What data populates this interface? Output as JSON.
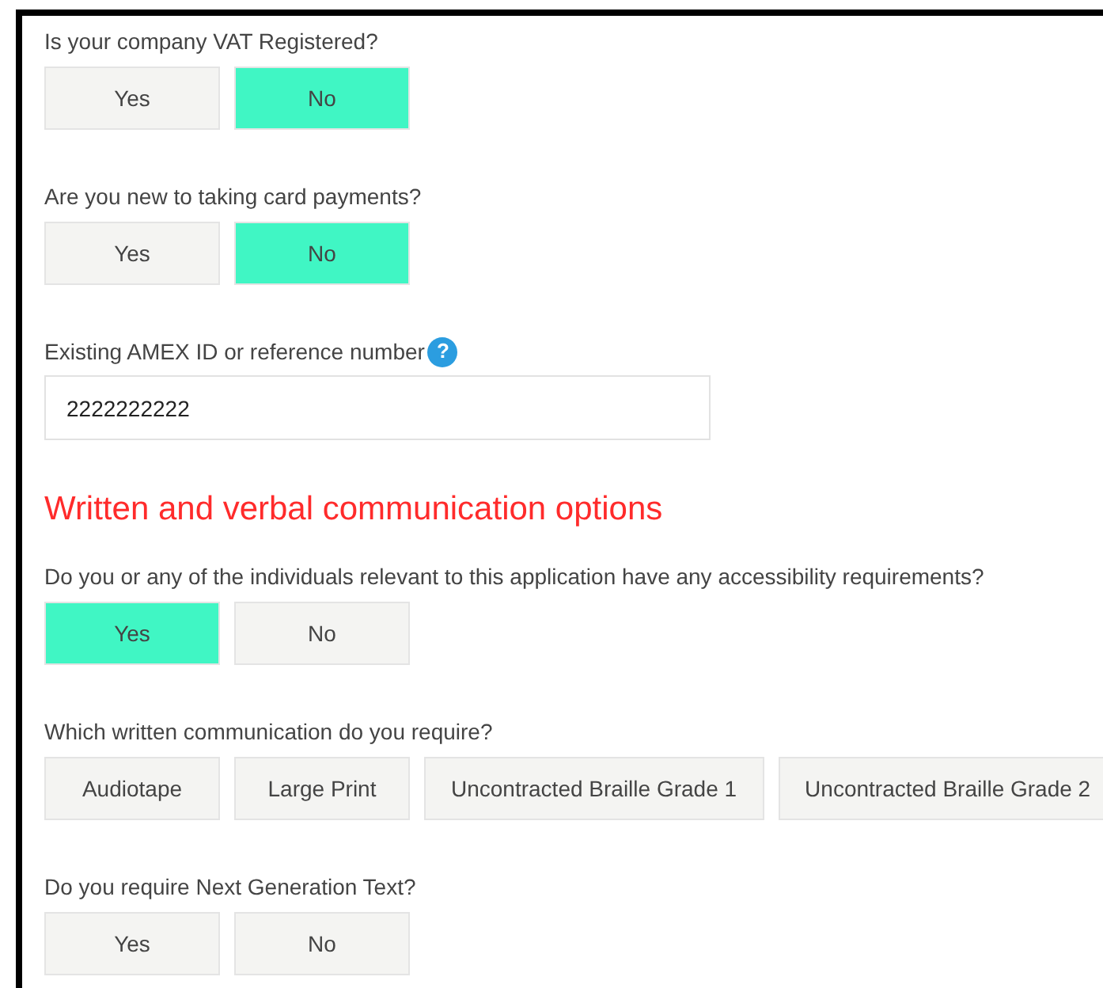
{
  "form": [
    {
      "kind": "choice",
      "question": "Is your company VAT Registered?",
      "options": [
        {
          "label": "Yes",
          "selected": false
        },
        {
          "label": "No",
          "selected": true
        }
      ]
    },
    {
      "kind": "choice",
      "question": "Are you new to taking card payments?",
      "options": [
        {
          "label": "Yes",
          "selected": false
        },
        {
          "label": "No",
          "selected": true
        }
      ]
    },
    {
      "kind": "text_input",
      "question": "Existing AMEX ID or reference number",
      "help": "?",
      "value": "2222222222"
    },
    {
      "kind": "heading",
      "text": "Written and verbal communication options"
    },
    {
      "kind": "choice",
      "question": "Do you or any of the individuals relevant to this application have any accessibility requirements?",
      "options": [
        {
          "label": "Yes",
          "selected": true
        },
        {
          "label": "No",
          "selected": false
        }
      ]
    },
    {
      "kind": "choice",
      "question": "Which written communication do you require?",
      "options": [
        {
          "label": "Audiotape",
          "selected": false
        },
        {
          "label": "Large Print",
          "selected": false
        },
        {
          "label": "Uncontracted Braille Grade 1",
          "selected": false
        },
        {
          "label": "Uncontracted Braille Grade 2",
          "selected": false
        }
      ]
    },
    {
      "kind": "choice",
      "question": "Do you require Next Generation Text?",
      "options": [
        {
          "label": "Yes",
          "selected": false
        },
        {
          "label": "No",
          "selected": false
        }
      ]
    }
  ]
}
